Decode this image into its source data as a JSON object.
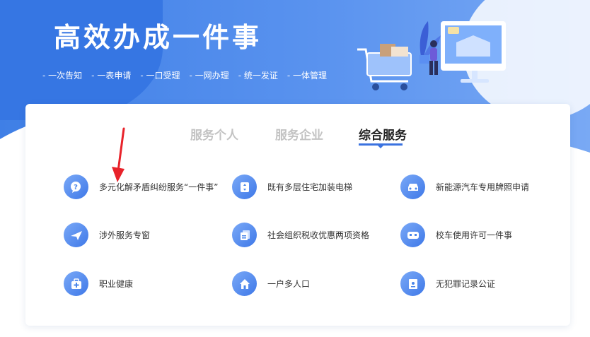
{
  "hero": {
    "title": "高效办成一件事",
    "tags": [
      "一次告知",
      "一表申请",
      "一口受理",
      "一网办理",
      "统一发证",
      "一体管理"
    ]
  },
  "tabs": [
    {
      "label": "服务个人",
      "active": false
    },
    {
      "label": "服务企业",
      "active": false
    },
    {
      "label": "综合服务",
      "active": true
    }
  ],
  "services": [
    {
      "label": "多元化解矛盾纠纷服务“一件事”",
      "icon": "chat-question-icon"
    },
    {
      "label": "既有多层住宅加装电梯",
      "icon": "elevator-icon"
    },
    {
      "label": "新能源汽车专用牌照申请",
      "icon": "car-icon"
    },
    {
      "label": "涉外服务专窗",
      "icon": "airplane-icon"
    },
    {
      "label": "社会组织税收优惠两项资格",
      "icon": "documents-icon"
    },
    {
      "label": "校车使用许可一件事",
      "icon": "bus-icon"
    },
    {
      "label": "职业健康",
      "icon": "medical-kit-icon"
    },
    {
      "label": "一户多人口",
      "icon": "house-icon"
    },
    {
      "label": "无犯罪记录公证",
      "icon": "certificate-icon"
    }
  ],
  "colors": {
    "accent": "#3b73e0",
    "banner": "#4a86ea",
    "annotation_arrow": "#e8222a"
  }
}
